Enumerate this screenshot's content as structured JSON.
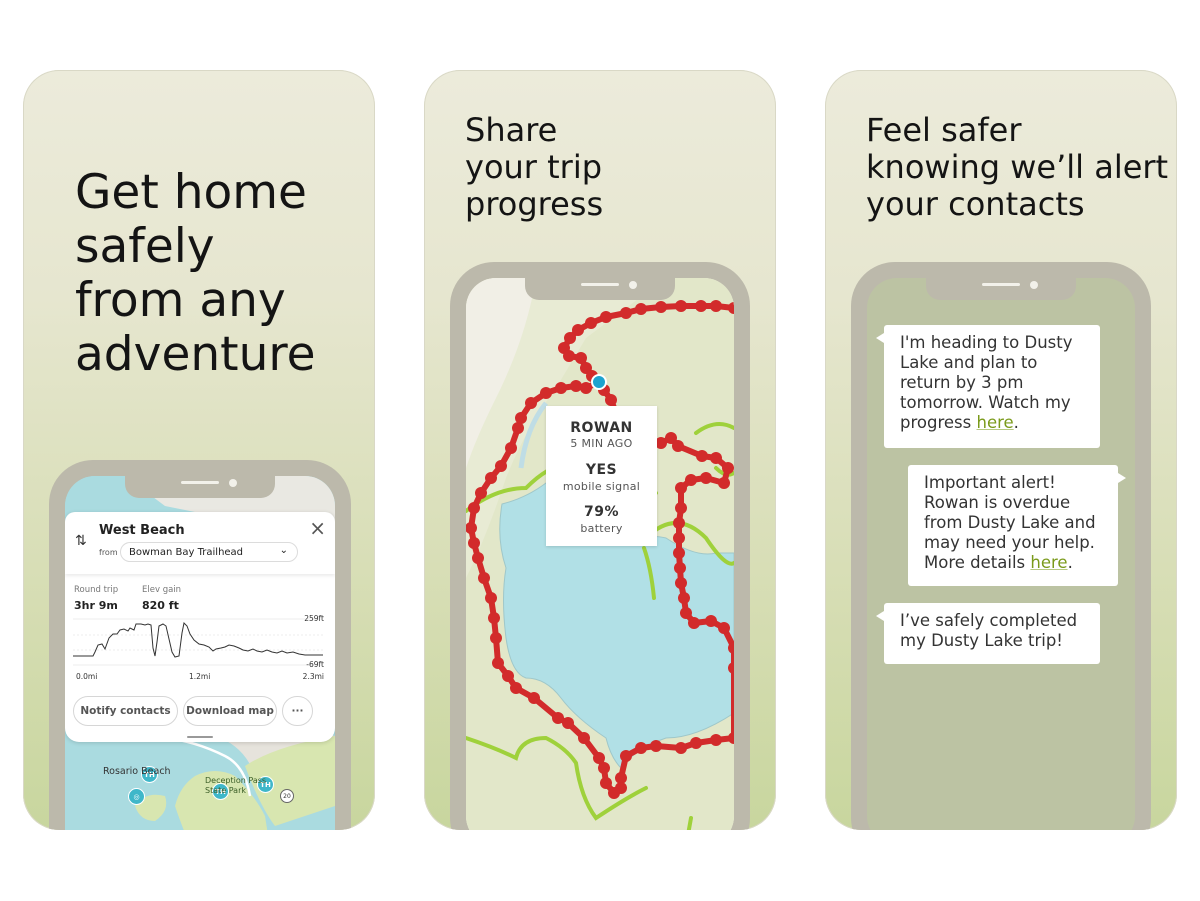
{
  "panels": [
    {
      "headline": [
        "Get home",
        "safely",
        "from any",
        "adventure"
      ],
      "route_card": {
        "destination": "West Beach",
        "from_label": "from",
        "from_value": "Bowman Bay Trailhead",
        "stats": [
          {
            "label": "Round trip",
            "value": "3hr 9m"
          },
          {
            "label": "Elev gain",
            "value": "820 ft"
          }
        ],
        "elevation_chart": {
          "y_max_label": "259ft",
          "y_min_label": "-69ft",
          "x_labels": [
            "0.0mi",
            "1.2mi",
            "2.3mi"
          ]
        },
        "actions": [
          "Notify contacts",
          "Download map",
          "···"
        ]
      },
      "map_labels": {
        "place_1": "Rosario Beach",
        "place_2": "Deception Pass State Park",
        "trailhead": "TH",
        "highway": "20"
      }
    },
    {
      "headline": [
        "Share",
        "your trip",
        "progress"
      ],
      "status_card": {
        "name": "ROWAN",
        "time": "5 MIN AGO",
        "signal_value": "YES",
        "signal_label": "mobile signal",
        "battery_value": "79%",
        "battery_label": "battery"
      }
    },
    {
      "headline": [
        "Feel safer",
        "knowing we’ll alert",
        "your contacts"
      ],
      "messages": [
        {
          "text": "I'm heading to Dusty Lake and plan to return by 3 pm tomorrow. Watch my progress ",
          "link": "here",
          "tail": "."
        },
        {
          "text": "Important alert! Rowan is overdue from Dusty Lake and may need your help. More details ",
          "link": "here",
          "tail": "."
        },
        {
          "text": "I’ve safely completed my Dusty Lake trip!",
          "link": "",
          "tail": ""
        }
      ]
    }
  ],
  "colors": {
    "route_red": "#d22b2b",
    "trail_green": "#9fd13b",
    "water_blue": "#aadfe6",
    "link_green": "#7a9a1a",
    "pin_teal": "#3fb7c9",
    "phone_frame": "#bcb9ab"
  }
}
